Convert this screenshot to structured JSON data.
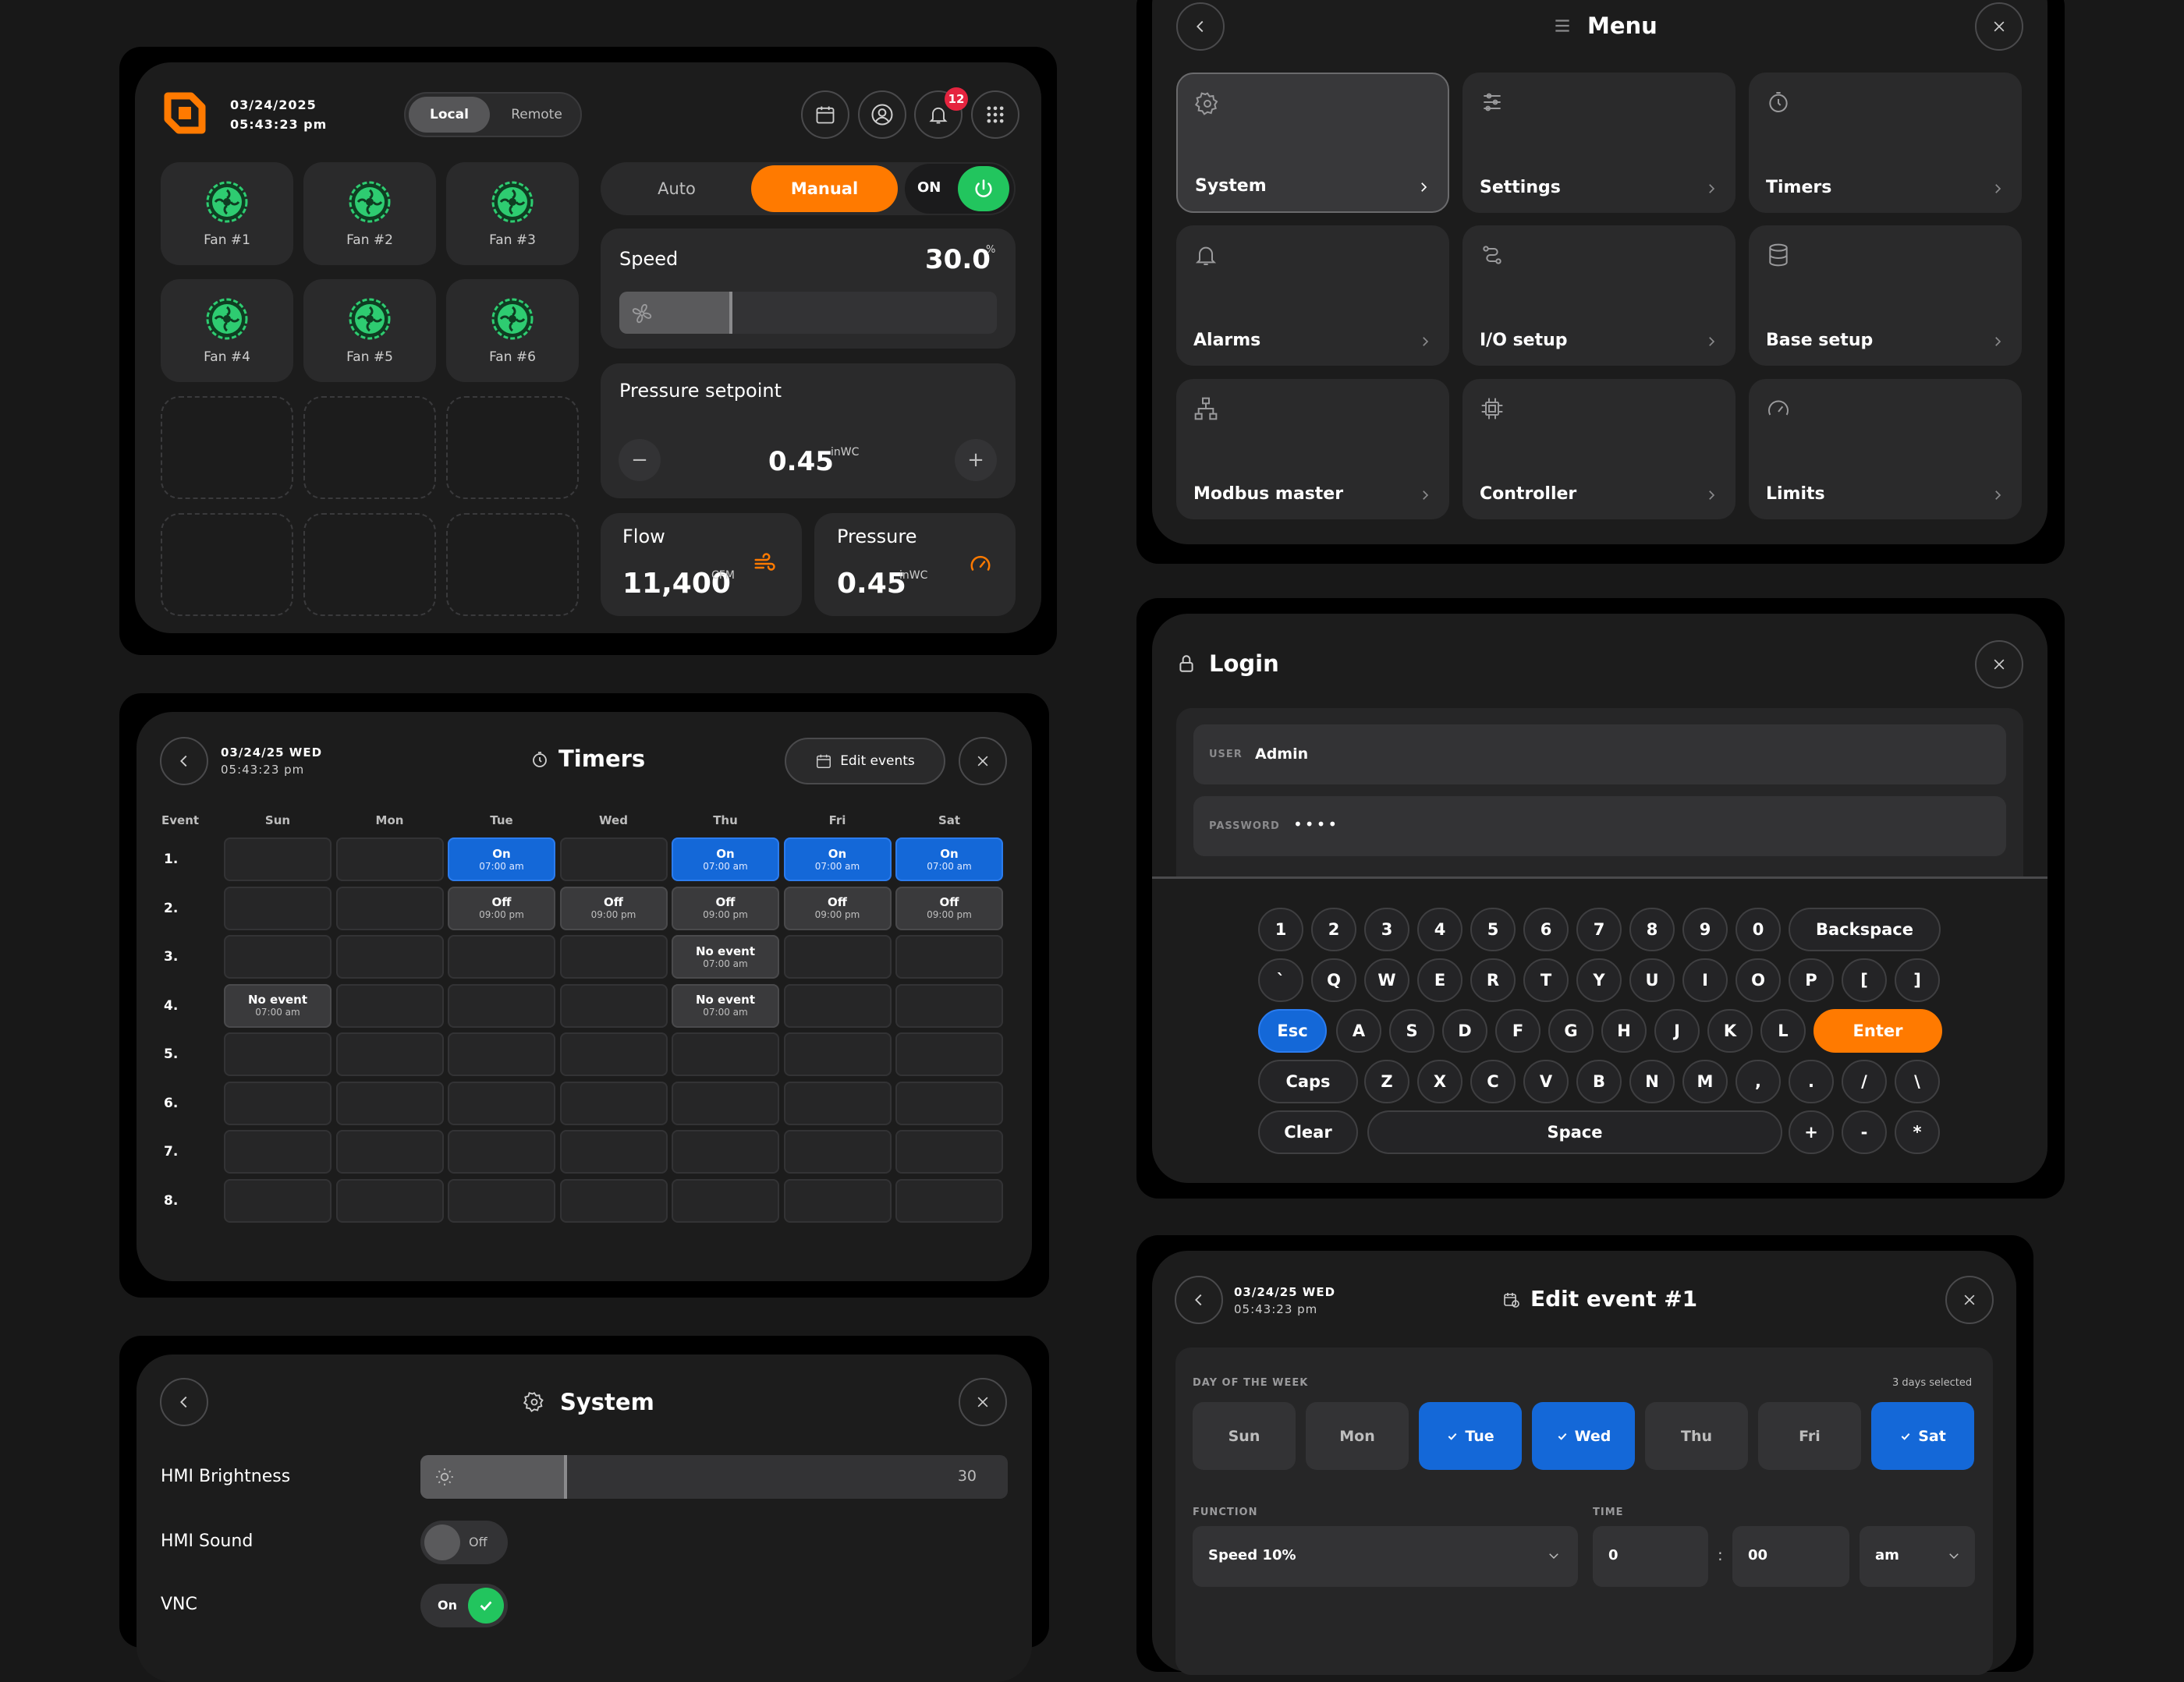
{
  "dashboard": {
    "date": "03/24/2025",
    "time": "05:43:23 pm",
    "modes": [
      "Local",
      "Remote"
    ],
    "notif_count": "12",
    "fans": [
      "Fan #1",
      "Fan #2",
      "Fan #3",
      "Fan #4",
      "Fan #5",
      "Fan #6"
    ],
    "control": {
      "auto": "Auto",
      "manual": "Manual",
      "on": "ON"
    },
    "speed": {
      "label": "Speed",
      "value": "30.0",
      "unit": "%",
      "level": 0.3
    },
    "pressure_setpoint": {
      "label": "Pressure setpoint",
      "value": "0.45",
      "unit": "inWC",
      "minus": "−",
      "plus": "+"
    },
    "flow": {
      "label": "Flow",
      "value": "11,400",
      "unit": "CFM"
    },
    "pressure": {
      "label": "Pressure",
      "value": "0.45",
      "unit": "inWC"
    }
  },
  "timers": {
    "date": "03/24/25 WED",
    "time": "05:43:23 pm",
    "title": "Timers",
    "edit_label": "Edit events",
    "event_header": "Event",
    "days": [
      "Sun",
      "Mon",
      "Tue",
      "Wed",
      "Thu",
      "Fri",
      "Sat"
    ],
    "rows": [
      "1.",
      "2.",
      "3.",
      "4.",
      "5.",
      "6.",
      "7.",
      "8."
    ],
    "events": [
      {
        "row": 0,
        "col": 2,
        "label": "On",
        "time": "07:00 am",
        "kind": "on"
      },
      {
        "row": 0,
        "col": 4,
        "label": "On",
        "time": "07:00 am",
        "kind": "on"
      },
      {
        "row": 0,
        "col": 5,
        "label": "On",
        "time": "07:00 am",
        "kind": "on"
      },
      {
        "row": 0,
        "col": 6,
        "label": "On",
        "time": "07:00 am",
        "kind": "on"
      },
      {
        "row": 1,
        "col": 2,
        "label": "Off",
        "time": "09:00 pm",
        "kind": "ev"
      },
      {
        "row": 1,
        "col": 3,
        "label": "Off",
        "time": "09:00 pm",
        "kind": "ev"
      },
      {
        "row": 1,
        "col": 4,
        "label": "Off",
        "time": "09:00 pm",
        "kind": "ev"
      },
      {
        "row": 1,
        "col": 5,
        "label": "Off",
        "time": "09:00 pm",
        "kind": "ev"
      },
      {
        "row": 1,
        "col": 6,
        "label": "Off",
        "time": "09:00 pm",
        "kind": "ev"
      },
      {
        "row": 2,
        "col": 4,
        "label": "No event",
        "time": "07:00 am",
        "kind": "ev"
      },
      {
        "row": 3,
        "col": 0,
        "label": "No event",
        "time": "07:00 am",
        "kind": "ev"
      },
      {
        "row": 3,
        "col": 4,
        "label": "No event",
        "time": "07:00 am",
        "kind": "ev"
      }
    ]
  },
  "system": {
    "title": "System",
    "brightness_label": "HMI Brightness",
    "brightness_value": "30",
    "brightness_level": 0.25,
    "sound_label": "HMI Sound",
    "sound_state": "Off",
    "vnc_label": "VNC",
    "vnc_state": "On"
  },
  "menu": {
    "title": "Menu",
    "items": [
      {
        "label": "System",
        "icon": "gear-icon"
      },
      {
        "label": "Settings",
        "icon": "sliders-icon"
      },
      {
        "label": "Timers",
        "icon": "timer-icon"
      },
      {
        "label": "Alarms",
        "icon": "bell-icon"
      },
      {
        "label": "I/O setup",
        "icon": "io-icon"
      },
      {
        "label": "Base setup",
        "icon": "database-icon"
      },
      {
        "label": "Modbus master",
        "icon": "network-icon"
      },
      {
        "label": "Controller",
        "icon": "chip-icon"
      },
      {
        "label": "Limits",
        "icon": "gauge-icon"
      }
    ]
  },
  "login": {
    "title": "Login",
    "user_label": "USER",
    "user_value": "Admin",
    "password_label": "PASSWORD",
    "password_mask": "••••",
    "keys": [
      [
        "1",
        "2",
        "3",
        "4",
        "5",
        "6",
        "7",
        "8",
        "9",
        "0",
        "Backspace"
      ],
      [
        "`",
        "Q",
        "W",
        "E",
        "R",
        "T",
        "Y",
        "U",
        "I",
        "O",
        "P",
        "[",
        "]"
      ],
      [
        "Esc",
        "A",
        "S",
        "D",
        "F",
        "G",
        "H",
        "J",
        "K",
        "L",
        "Enter"
      ],
      [
        "Caps",
        "Z",
        "X",
        "C",
        "V",
        "B",
        "N",
        "M",
        ",",
        ".",
        "/",
        "\\"
      ],
      [
        "Clear",
        "Space",
        "+",
        "-",
        "*"
      ]
    ]
  },
  "edit_event": {
    "date": "03/24/25 WED",
    "time": "05:43:23 pm",
    "title": "Edit event #1",
    "dow_label": "DAY OF THE WEEK",
    "selected_text": "3 days selected",
    "days": [
      {
        "label": "Sun",
        "sel": false
      },
      {
        "label": "Mon",
        "sel": false
      },
      {
        "label": "Tue",
        "sel": true
      },
      {
        "label": "Wed",
        "sel": true
      },
      {
        "label": "Thu",
        "sel": false
      },
      {
        "label": "Fri",
        "sel": false
      },
      {
        "label": "Sat",
        "sel": true
      }
    ],
    "function_label": "FUNCTION",
    "function_value": "Speed 10%",
    "time_label": "TIME",
    "hour": "0",
    "sep": ":",
    "minute": "00",
    "ampm": "am"
  },
  "colors": {
    "accent": "#ff7a00",
    "blue": "#1468d8",
    "green": "#22c55e",
    "fan_green": "#2ecc71",
    "badge_red": "#e5243f"
  }
}
